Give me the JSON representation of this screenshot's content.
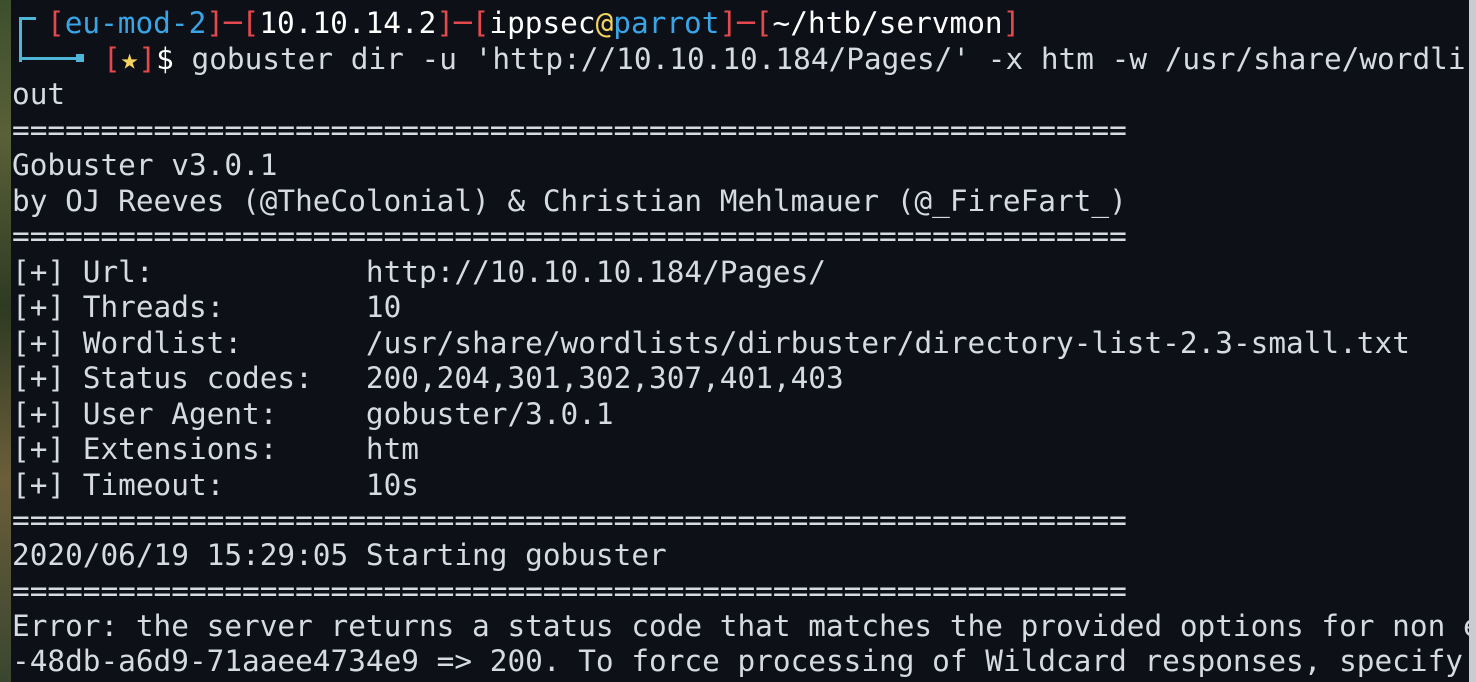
{
  "prompt": {
    "context": "eu-mod-2",
    "ip": "10.10.14.2",
    "user": "ippsec",
    "at": "@",
    "host": "parrot",
    "path": "~/htb/servmon",
    "star": "★",
    "dollar": "$",
    "command": " gobuster dir -u 'http://10.10.10.184/Pages/' -x htm -w /usr/share/wordli"
  },
  "output": {
    "wrap_line": "out",
    "separator": "===============================================================",
    "banner_title": "Gobuster v3.0.1",
    "banner_credit": "by OJ Reeves (@TheColonial) & Christian Mehlmauer (@_FireFart_)",
    "config": [
      {
        "key": "[+] Url:            ",
        "value": "http://10.10.10.184/Pages/"
      },
      {
        "key": "[+] Threads:        ",
        "value": "10"
      },
      {
        "key": "[+] Wordlist:       ",
        "value": "/usr/share/wordlists/dirbuster/directory-list-2.3-small.txt"
      },
      {
        "key": "[+] Status codes:   ",
        "value": "200,204,301,302,307,401,403"
      },
      {
        "key": "[+] User Agent:     ",
        "value": "gobuster/3.0.1"
      },
      {
        "key": "[+] Extensions:     ",
        "value": "htm"
      },
      {
        "key": "[+] Timeout:        ",
        "value": "10s"
      }
    ],
    "start_line": "2020/06/19 15:29:05 Starting gobuster",
    "error_line_1": "Error: the server returns a status code that matches the provided options for non e",
    "error_line_2": "-48db-a6d9-71aaee4734e9 => 200. To force processing of Wildcard responses, specify"
  },
  "colors": {
    "background": "#0d1117",
    "text": "#d6dbe1",
    "bracket_red": "#e5484d",
    "prompt_blue": "#39a5e6",
    "star_yellow": "#f4d35e",
    "frame_cyan": "#4fb6d8"
  }
}
